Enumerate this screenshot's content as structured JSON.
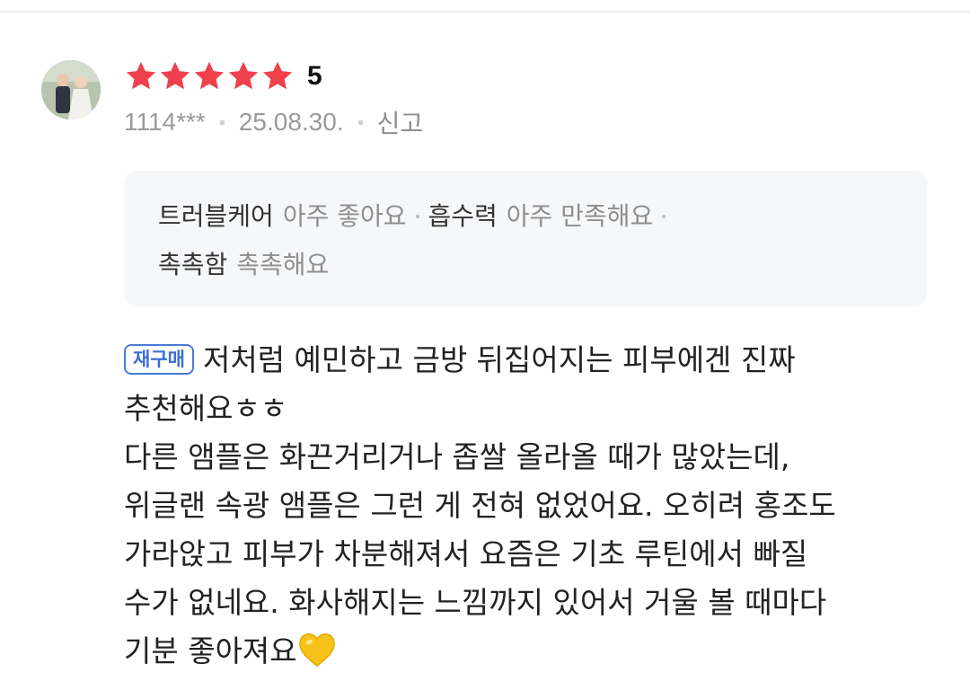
{
  "review": {
    "rating": {
      "value": 5,
      "max": 5,
      "display": "5",
      "star_color": "#f0404c"
    },
    "user_id": "1114***",
    "date": "25.08.30.",
    "report_label": "신고",
    "attributes": [
      {
        "label": "트러블케어",
        "value": "아주 좋아요"
      },
      {
        "label": "흡수력",
        "value": "아주 만족해요"
      },
      {
        "label": "촉촉함",
        "value": "촉촉해요"
      }
    ],
    "badge": "재구매",
    "badge_color": "#3a6fd8",
    "body_lines": [
      "저처럼 예민하고 금방 뒤집어지는 피부에겐 진짜",
      "추천해요ㅎㅎ",
      "다른 앰플은 화끈거리거나 좁쌀 올라올 때가 많았는데,",
      "위글랜 속광 앰플은 그런 게 전혀 없었어요. 오히려 홍조도",
      "가라앉고 피부가 차분해져서 요즘은 기초 루틴에서 빠질",
      "수가 없네요. 화사해지는 느낌까지 있어서 거울 볼 때마다",
      "기분 좋아져요"
    ],
    "end_emoji_icon": "yellow-heart-icon"
  }
}
